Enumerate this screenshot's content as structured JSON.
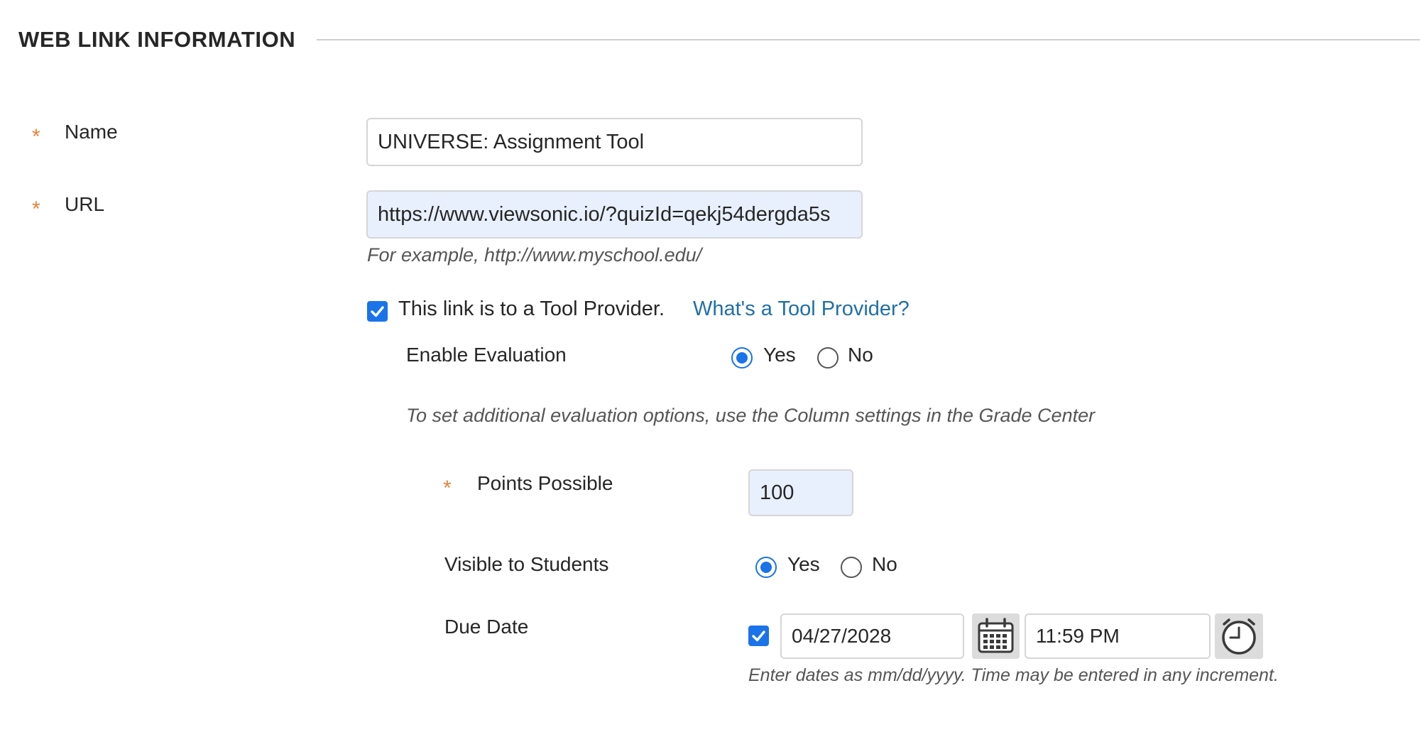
{
  "section": {
    "title": "WEB LINK INFORMATION"
  },
  "name_field": {
    "required_marker": "*",
    "label": "Name",
    "value": "UNIVERSE: Assignment Tool"
  },
  "url_field": {
    "required_marker": "*",
    "label": "URL",
    "value": "https://www.viewsonic.io/?quizId=qekj54dergda5s",
    "hint": "For example, http://www.myschool.edu/"
  },
  "tool_provider": {
    "checked": true,
    "label": "This link is to a Tool Provider.",
    "help_link": "What's a Tool Provider?"
  },
  "enable_evaluation": {
    "label": "Enable Evaluation",
    "yes_label": "Yes",
    "no_label": "No",
    "selected": "Yes",
    "note": "To set additional evaluation options, use the Column settings in the Grade Center"
  },
  "points_possible": {
    "required_marker": "*",
    "label": "Points Possible",
    "value": "100"
  },
  "visible_to_students": {
    "label": "Visible to Students",
    "yes_label": "Yes",
    "no_label": "No",
    "selected": "Yes"
  },
  "due_date": {
    "label": "Due Date",
    "enabled": true,
    "date_value": "04/27/2028",
    "time_value": "11:59 PM",
    "hint": "Enter dates as mm/dd/yyyy. Time may be entered in any increment.",
    "calendar_icon": "calendar-icon",
    "clock_icon": "clock-icon"
  },
  "colors": {
    "accent": "#1a73e8",
    "required": "#e8833a",
    "link": "#1f6fab",
    "filled_input": "#e8f0fe"
  }
}
